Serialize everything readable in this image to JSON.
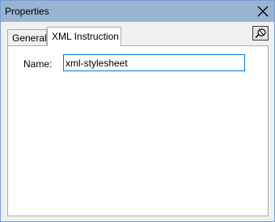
{
  "window": {
    "title": "Properties"
  },
  "tabs": [
    {
      "label": "General",
      "selected": false
    },
    {
      "label": "XML Instruction",
      "selected": true
    }
  ],
  "form": {
    "name_label": "Name:",
    "name_value": "xml-stylesheet"
  },
  "icons": {
    "close": "close-icon",
    "pin": "pin-icon"
  },
  "colors": {
    "titlebar": "#99b4d1",
    "focus_border": "#0078d7"
  }
}
